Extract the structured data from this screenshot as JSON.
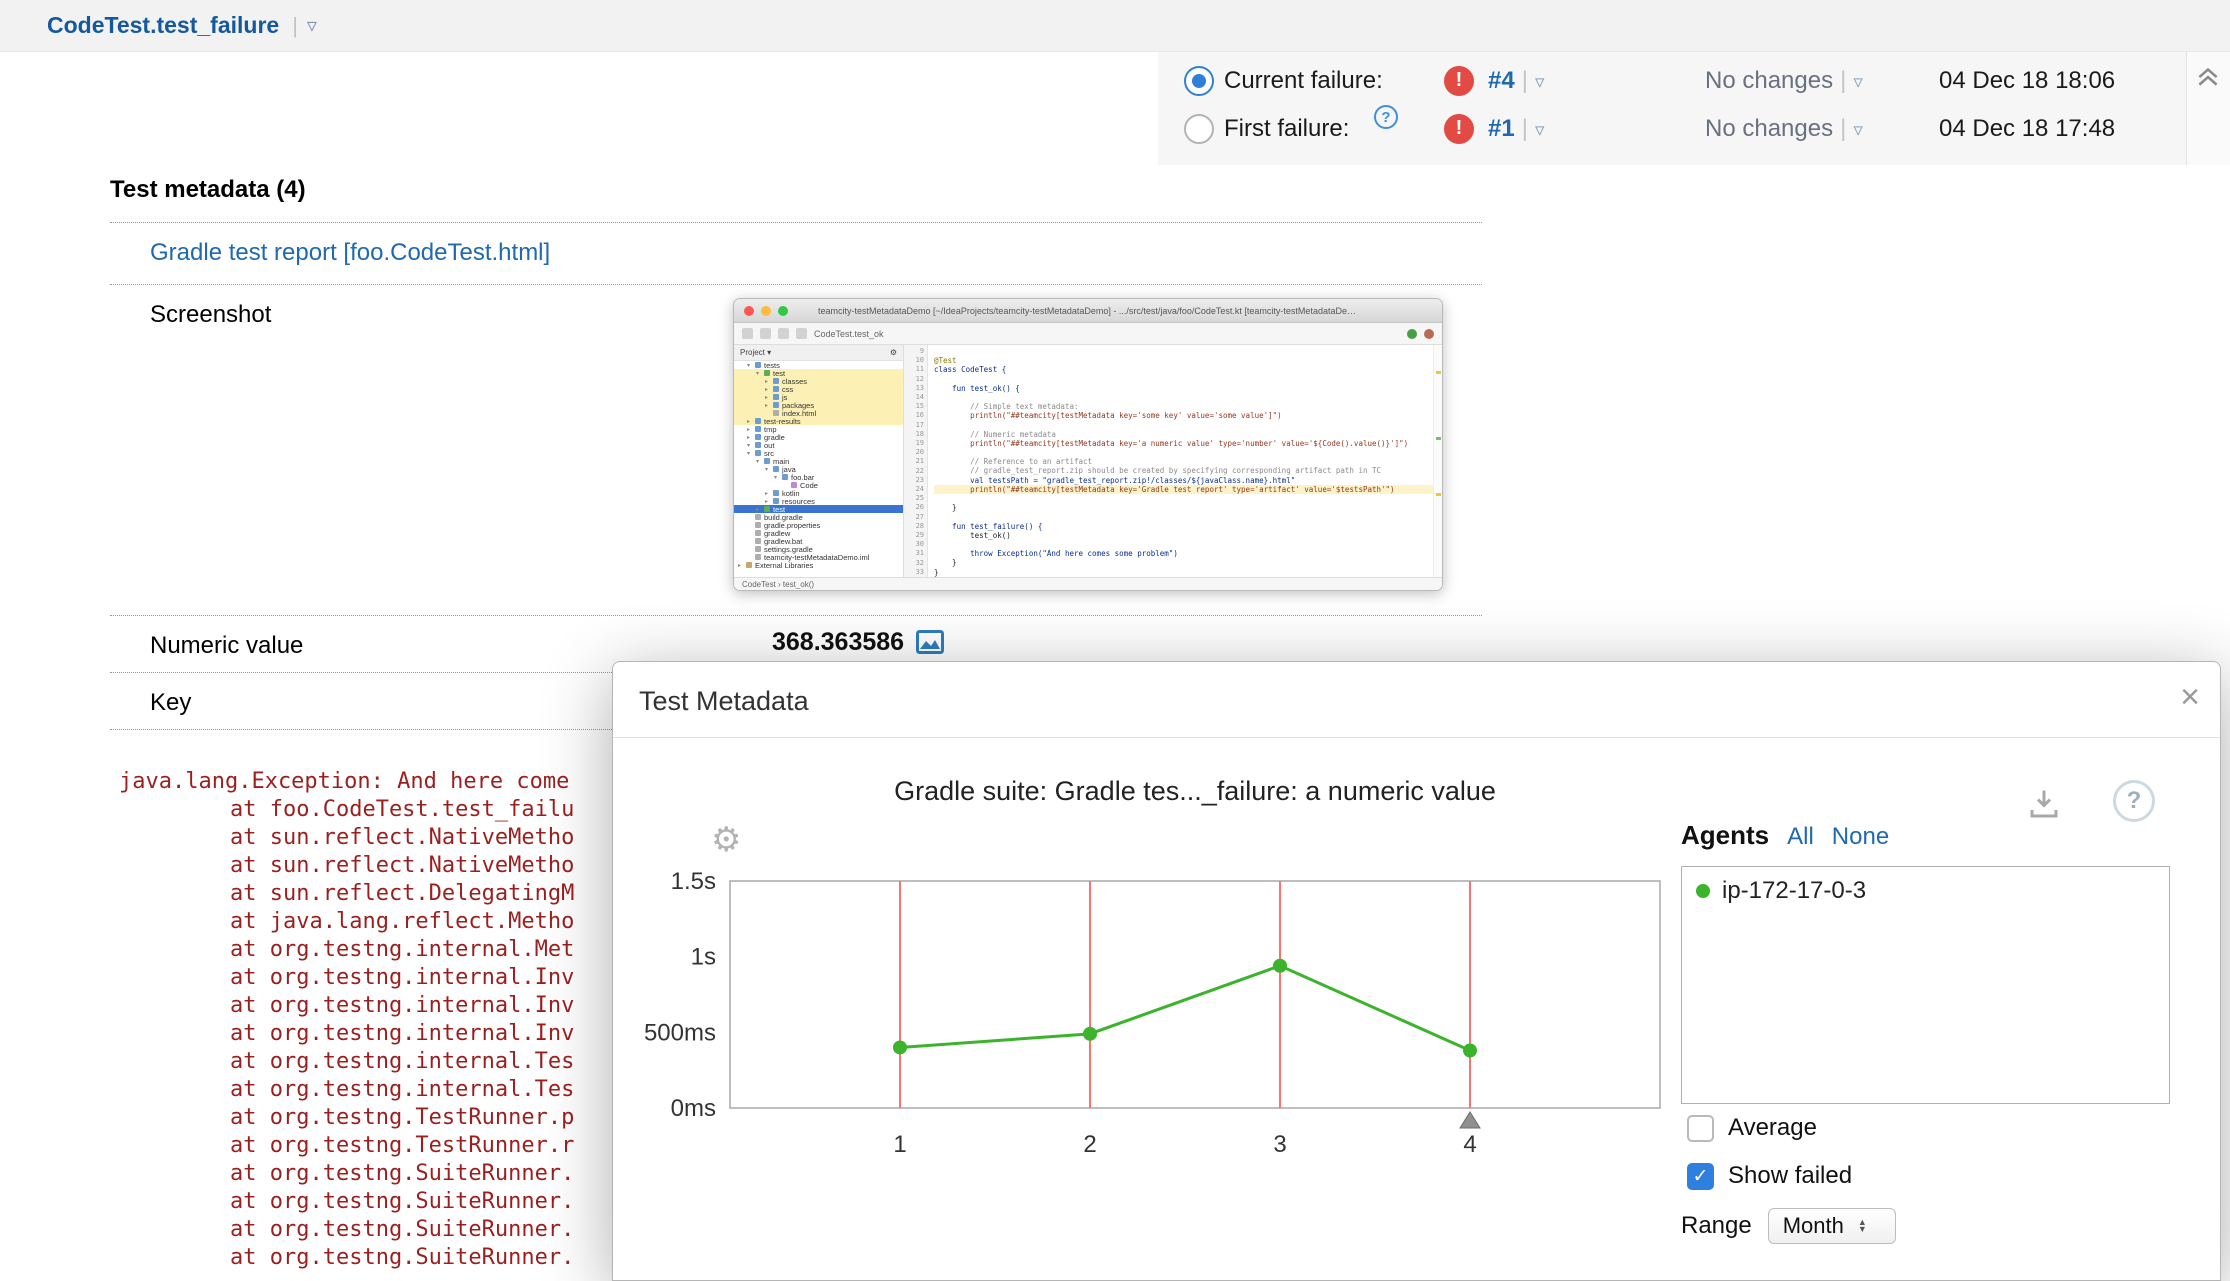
{
  "header": {
    "test_name": "CodeTest.test_failure",
    "dropdown_icon": "▿"
  },
  "failure_panel": {
    "error_icon": "!",
    "help_icon": "?",
    "rows": [
      {
        "label": "Current failure:",
        "build": "#4",
        "changes": "No changes",
        "date": "04 Dec 18 18:06",
        "selected": true
      },
      {
        "label": "First failure:",
        "build": "#1",
        "changes": "No changes",
        "date": "04 Dec 18 17:48",
        "selected": false
      }
    ]
  },
  "metadata": {
    "heading": "Test metadata (4)",
    "report_link_label": "Gradle test report [foo.CodeTest.html]",
    "screenshot_label": "Screenshot",
    "numeric_label": "Numeric value",
    "numeric_value": "368.363586",
    "key_label": "Key"
  },
  "stacktrace": {
    "lines": [
      "java.lang.Exception: And here come",
      "at foo.CodeTest.test_failu",
      "at sun.reflect.NativeMetho",
      "at sun.reflect.NativeMetho",
      "at sun.reflect.DelegatingM",
      "at java.lang.reflect.Metho",
      "at org.testng.internal.Met",
      "at org.testng.internal.Inv",
      "at org.testng.internal.Inv",
      "at org.testng.internal.Inv",
      "at org.testng.internal.Tes",
      "at org.testng.internal.Tes",
      "at org.testng.TestRunner.p",
      "at org.testng.TestRunner.r",
      "at org.testng.SuiteRunner.",
      "at org.testng.SuiteRunner.",
      "at org.testng.SuiteRunner.",
      "at org.testng.SuiteRunner."
    ]
  },
  "modal": {
    "title": "Test Metadata",
    "close_icon": "×",
    "gear_icon": "⚙",
    "help_icon": "?",
    "agents": {
      "heading": "Agents",
      "all_label": "All",
      "none_label": "None",
      "items": [
        {
          "name": "ip-172-17-0-3",
          "color": "#3cb32c"
        }
      ]
    },
    "average_label": "Average",
    "average_checked": false,
    "show_failed_label": "Show failed",
    "show_failed_checked": true,
    "range_label": "Range",
    "range_value": "Month"
  },
  "chart_data": {
    "type": "line",
    "title": "Gradle suite: Gradle tes..._failure: a numeric value",
    "x_labels": [
      "1",
      "2",
      "3",
      "4"
    ],
    "series": [
      {
        "name": "ip-172-17-0-3",
        "color": "#3cb32c",
        "values_ms": [
          400,
          490,
          940,
          380
        ]
      }
    ],
    "failed_runs_x": [
      1,
      2,
      3,
      4
    ],
    "y_ticks": [
      {
        "ms": 0,
        "label": "0ms"
      },
      {
        "ms": 500,
        "label": "500ms"
      },
      {
        "ms": 1000,
        "label": "1s"
      },
      {
        "ms": 1500,
        "label": "1.5s"
      }
    ],
    "ylim_ms": [
      0,
      1500
    ],
    "fail_line_color": "#ff7070",
    "marker_x": 4,
    "grid": false,
    "legend_position": "right-listbox"
  },
  "ide": {
    "window_title": "teamcity-testMetadataDemo [~/IdeaProjects/teamcity-testMetadataDemo] - .../src/test/java/foo/CodeTest.kt [teamcity-testMetadataDemo.test]",
    "toolbar_text": "CodeTest.test_ok",
    "panel_title": "Project ▾",
    "status_text": "CodeTest › test_ok()",
    "tree": [
      {
        "label": "tests",
        "indent": 1,
        "arrow": "▾",
        "kind": "dir"
      },
      {
        "label": "test",
        "indent": 2,
        "arrow": "▾",
        "kind": "test",
        "hl": "yellow"
      },
      {
        "label": "classes",
        "indent": 3,
        "arrow": "▸",
        "kind": "dir",
        "hl": "yellow"
      },
      {
        "label": "css",
        "indent": 3,
        "arrow": "▸",
        "kind": "dir",
        "hl": "yellow"
      },
      {
        "label": "js",
        "indent": 3,
        "arrow": "▸",
        "kind": "dir",
        "hl": "yellow"
      },
      {
        "label": "packages",
        "indent": 3,
        "arrow": "▸",
        "kind": "dir",
        "hl": "yellow"
      },
      {
        "label": "index.html",
        "indent": 3,
        "arrow": "",
        "kind": "file",
        "hl": "yellow"
      },
      {
        "label": "test-results",
        "indent": 1,
        "arrow": "▸",
        "kind": "dir",
        "hl": "yellow"
      },
      {
        "label": "tmp",
        "indent": 1,
        "arrow": "▸",
        "kind": "dir"
      },
      {
        "label": "gradle",
        "indent": 1,
        "arrow": "▸",
        "kind": "dir"
      },
      {
        "label": "out",
        "indent": 1,
        "arrow": "▾",
        "kind": "dir"
      },
      {
        "label": "src",
        "indent": 1,
        "arrow": "▾",
        "kind": "dir"
      },
      {
        "label": "main",
        "indent": 2,
        "arrow": "▾",
        "kind": "dir"
      },
      {
        "label": "java",
        "indent": 3,
        "arrow": "▾",
        "kind": "dir"
      },
      {
        "label": "foo.bar",
        "indent": 4,
        "arrow": "▾",
        "kind": "pkg"
      },
      {
        "label": "Code",
        "indent": 5,
        "arrow": "",
        "kind": "class"
      },
      {
        "label": "kotlin",
        "indent": 3,
        "arrow": "▸",
        "kind": "dir"
      },
      {
        "label": "resources",
        "indent": 3,
        "arrow": "▸",
        "kind": "dir"
      },
      {
        "label": "test",
        "indent": 2,
        "arrow": "▸",
        "kind": "test",
        "hl": "blue"
      },
      {
        "label": "build.gradle",
        "indent": 1,
        "arrow": "",
        "kind": "file"
      },
      {
        "label": "gradle.properties",
        "indent": 1,
        "arrow": "",
        "kind": "file"
      },
      {
        "label": "gradlew",
        "indent": 1,
        "arrow": "",
        "kind": "file"
      },
      {
        "label": "gradlew.bat",
        "indent": 1,
        "arrow": "",
        "kind": "file"
      },
      {
        "label": "settings.gradle",
        "indent": 1,
        "arrow": "",
        "kind": "file"
      },
      {
        "label": "teamcity-testMetadataDemo.iml",
        "indent": 1,
        "arrow": "",
        "kind": "file"
      },
      {
        "label": "External Libraries",
        "indent": 0,
        "arrow": "▸",
        "kind": "lib"
      }
    ],
    "code": [
      {
        "n": "9",
        "t": "",
        "c": "pl"
      },
      {
        "n": "10",
        "t": "@Test",
        "c": "ann"
      },
      {
        "n": "11",
        "t": "class CodeTest {",
        "c": "kw"
      },
      {
        "n": "12",
        "t": "",
        "c": "pl"
      },
      {
        "n": "13",
        "t": "    fun test_ok() {",
        "c": "kw"
      },
      {
        "n": "14",
        "t": "",
        "c": "pl"
      },
      {
        "n": "15",
        "t": "        // Simple text metadata:",
        "c": "cmt"
      },
      {
        "n": "16",
        "t": "        println(\"##teamcity[testMetadata key='some key' value='some value']\")",
        "c": "str"
      },
      {
        "n": "17",
        "t": "",
        "c": "pl"
      },
      {
        "n": "18",
        "t": "        // Numeric metadata",
        "c": "cmt"
      },
      {
        "n": "19",
        "t": "        println(\"##teamcity[testMetadata key='a numeric value' type='number' value='${Code().value()}']\")",
        "c": "str"
      },
      {
        "n": "20",
        "t": "",
        "c": "pl"
      },
      {
        "n": "21",
        "t": "        // Reference to an artifact",
        "c": "cmt"
      },
      {
        "n": "22",
        "t": "        // gradle_test_report.zip should be created by specifying corresponding artifact path in TC",
        "c": "cmt"
      },
      {
        "n": "23",
        "t": "        val testsPath = \"gradle_test_report.zip!/classes/${javaClass.name}.html\"",
        "c": "kw"
      },
      {
        "n": "24",
        "t": "        println(\"##teamcity[testMetadata key='Gradle test report' type='artifact' value='$testsPath'\")",
        "c": "str",
        "hl": true
      },
      {
        "n": "25",
        "t": "",
        "c": "pl"
      },
      {
        "n": "26",
        "t": "    }",
        "c": "pl"
      },
      {
        "n": "27",
        "t": "",
        "c": "pl"
      },
      {
        "n": "28",
        "t": "    fun test_failure() {",
        "c": "kw"
      },
      {
        "n": "29",
        "t": "        test_ok()",
        "c": "pl"
      },
      {
        "n": "30",
        "t": "",
        "c": "pl"
      },
      {
        "n": "31",
        "t": "        throw Exception(\"And here comes some problem\")",
        "c": "kw"
      },
      {
        "n": "32",
        "t": "    }",
        "c": "pl"
      },
      {
        "n": "33",
        "t": "}",
        "c": "pl"
      }
    ]
  }
}
